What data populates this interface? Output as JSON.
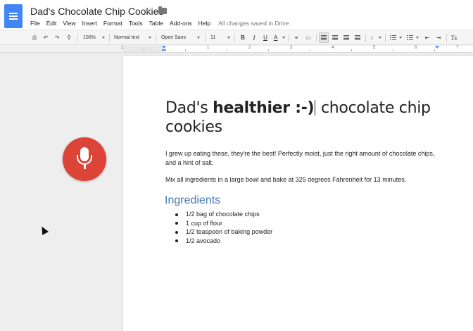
{
  "header": {
    "title": "Dad's Chocolate Chip Cookies",
    "save_status": "All changes saved in Drive"
  },
  "menu": [
    "File",
    "Edit",
    "View",
    "Insert",
    "Format",
    "Tools",
    "Table",
    "Add-ons",
    "Help"
  ],
  "toolbar": {
    "zoom": "100%",
    "style": "Normal text",
    "font": "Open Sans",
    "font_size": "11",
    "bold": "B",
    "italic": "I",
    "underline": "U",
    "text_color": "A",
    "clear_format": "Tx"
  },
  "ruler": [
    "1",
    "1",
    "2",
    "3",
    "4",
    "5",
    "6",
    "7"
  ],
  "document": {
    "title_part1": "Dad's ",
    "title_bold": "healthier :-)",
    "title_part2": " chocolate chip cookies",
    "para1": "I grew up eating these, they're the best!  Perfectly moist, just the right amount of chocolate chips, and a hint of salt.",
    "para2": "Mix all ingredients in a large bowl and bake at 325 degrees Fahrenheit for 13 minutes.",
    "ingredients_heading": "Ingredients",
    "ingredients": [
      "1/2 bag of chocolate chips",
      "1 cup of flour",
      "1/2 teaspoon of baking powder",
      "1/2 avocado"
    ]
  },
  "colors": {
    "docs_blue": "#4285f4",
    "mic_red": "#db4437",
    "heading_blue": "#4a78b0"
  },
  "icons": [
    "docs-logo-icon",
    "star-icon",
    "folder-icon",
    "print-icon",
    "undo-icon",
    "redo-icon",
    "paint-format-icon",
    "link-icon",
    "comment-icon",
    "align-left-icon",
    "align-center-icon",
    "align-right-icon",
    "align-justify-icon",
    "line-spacing-icon",
    "numbered-list-icon",
    "bulleted-list-icon",
    "decrease-indent-icon",
    "increase-indent-icon",
    "clear-formatting-icon",
    "microphone-icon",
    "mouse-cursor-icon"
  ]
}
